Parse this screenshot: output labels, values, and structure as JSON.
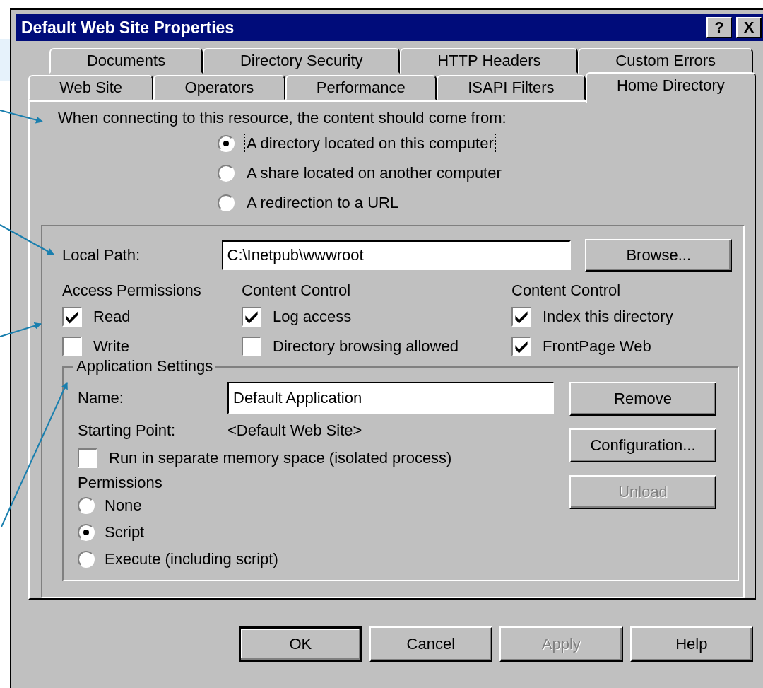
{
  "window": {
    "title": "Default Web Site Properties",
    "title_buttons": [
      "?",
      "X"
    ]
  },
  "tab_rows": [
    {
      "tabs": [
        {
          "label": "Documents",
          "selected": false
        },
        {
          "label": "Directory Security",
          "selected": false
        },
        {
          "label": "HTTP Headers",
          "selected": false
        },
        {
          "label": "Custom Errors",
          "selected": false
        }
      ]
    },
    {
      "tabs": [
        {
          "label": "Web Site",
          "selected": false
        },
        {
          "label": "Operators",
          "selected": false
        },
        {
          "label": "Performance",
          "selected": false
        },
        {
          "label": "ISAPI Filters",
          "selected": false
        },
        {
          "label": "Home Directory",
          "selected": true
        }
      ]
    }
  ],
  "content_source": {
    "prompt": "When connecting to this resource, the content should come from:",
    "options": [
      {
        "label": "A directory located on this computer",
        "selected": true,
        "focused": true
      },
      {
        "label": "A share located on another computer",
        "selected": false,
        "focused": false
      },
      {
        "label": "A redirection to a URL",
        "selected": false,
        "focused": false
      }
    ]
  },
  "local_path": {
    "label": "Local Path:",
    "value": "C:\\Inetpub\\wwwroot",
    "button": "Browse..."
  },
  "permission_columns": [
    {
      "heading": "Access Permissions",
      "items": [
        {
          "label": "Read",
          "checked": true
        },
        {
          "label": "Write",
          "checked": false
        }
      ]
    },
    {
      "heading": "Content Control",
      "items": [
        {
          "label": "Log access",
          "checked": true
        },
        {
          "label": "Directory browsing allowed",
          "checked": false
        }
      ]
    },
    {
      "heading": "Content Control",
      "items": [
        {
          "label": "Index this directory",
          "checked": true
        },
        {
          "label": "FrontPage Web",
          "checked": true
        }
      ]
    }
  ],
  "application_settings": {
    "title": "Application Settings",
    "name": {
      "label": "Name:",
      "value": "Default Application"
    },
    "starting_point": {
      "label": "Starting Point:",
      "value": "<Default Web Site>"
    },
    "isolated": {
      "label": "Run in separate memory space (isolated process)",
      "checked": false
    },
    "permissions": {
      "heading": "Permissions",
      "options": [
        {
          "label": "None",
          "selected": false
        },
        {
          "label": "Script",
          "selected": true
        },
        {
          "label": "Execute (including script)",
          "selected": false
        }
      ]
    },
    "buttons": [
      {
        "label": "Remove",
        "disabled": false
      },
      {
        "label": "Configuration...",
        "disabled": false
      },
      {
        "label": "Unload",
        "disabled": true
      }
    ]
  },
  "dialog_buttons": [
    {
      "label": "OK",
      "disabled": false,
      "default": true
    },
    {
      "label": "Cancel",
      "disabled": false,
      "default": false
    },
    {
      "label": "Apply",
      "disabled": true,
      "default": false
    },
    {
      "label": "Help",
      "disabled": false,
      "default": false
    }
  ]
}
